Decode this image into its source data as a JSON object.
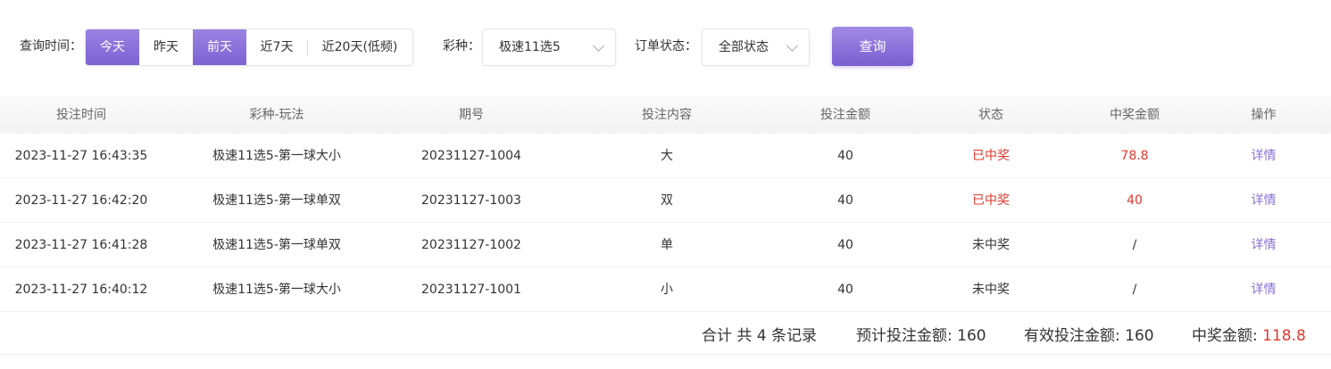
{
  "filters": {
    "time_label": "查询时间：",
    "time_options": [
      {
        "label": "今天",
        "active": true
      },
      {
        "label": "昨天",
        "active": false
      },
      {
        "label": "前天",
        "active": true
      },
      {
        "label": "近7天",
        "active": false
      },
      {
        "label": "近20天(低频)",
        "active": false
      }
    ],
    "lottery_label": "彩种：",
    "lottery_value": "极速11选5",
    "status_label": "订单状态：",
    "status_value": "全部状态",
    "query_label": "查询"
  },
  "table": {
    "headers": [
      "投注时间",
      "彩种-玩法",
      "期号",
      "投注内容",
      "投注金额",
      "状态",
      "中奖金额",
      "操作"
    ],
    "rows": [
      {
        "time": "2023-11-27 16:43:35",
        "game": "极速11选5-第一球大小",
        "issue": "20231127-1004",
        "content": "大",
        "amount": "40",
        "status": "已中奖",
        "won": true,
        "prize": "78.8",
        "action": "详情"
      },
      {
        "time": "2023-11-27 16:42:20",
        "game": "极速11选5-第一球单双",
        "issue": "20231127-1003",
        "content": "双",
        "amount": "40",
        "status": "已中奖",
        "won": true,
        "prize": "40",
        "action": "详情"
      },
      {
        "time": "2023-11-27 16:41:28",
        "game": "极速11选5-第一球单双",
        "issue": "20231127-1002",
        "content": "单",
        "amount": "40",
        "status": "未中奖",
        "won": false,
        "prize": "/",
        "action": "详情"
      },
      {
        "time": "2023-11-27 16:40:12",
        "game": "极速11选5-第一球大小",
        "issue": "20231127-1001",
        "content": "小",
        "amount": "40",
        "status": "未中奖",
        "won": false,
        "prize": "/",
        "action": "详情"
      }
    ]
  },
  "summary": {
    "total_label": "合计 共 4 条记录",
    "expected_label": "预计投注金额:",
    "expected_value": "160",
    "valid_label": "有效投注金额:",
    "valid_value": "160",
    "prize_label": "中奖金额:",
    "prize_value": "118.8"
  },
  "colors": {
    "accent": "#8a6fd6",
    "win_red": "#e0382d"
  }
}
